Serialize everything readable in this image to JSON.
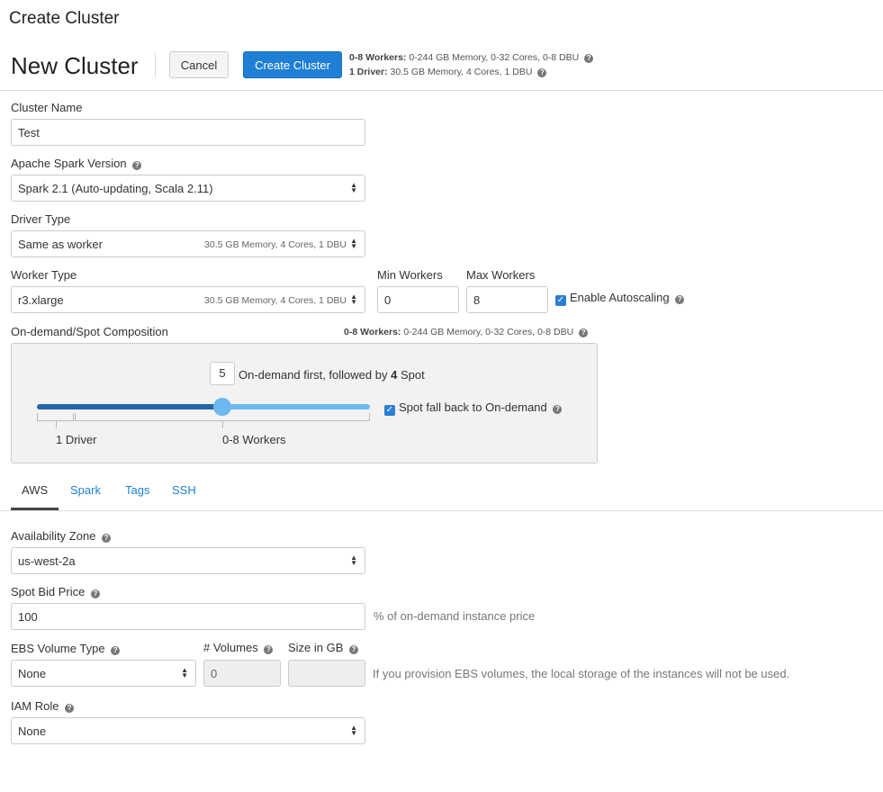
{
  "page": {
    "title": "Create Cluster"
  },
  "header": {
    "heading": "New Cluster",
    "cancel_label": "Cancel",
    "create_label": "Create Cluster",
    "workers_summary_label": "0-8 Workers:",
    "workers_summary_value": "0-244 GB Memory, 0-32 Cores, 0-8 DBU",
    "driver_summary_label": "1 Driver:",
    "driver_summary_value": "30.5 GB Memory, 4 Cores, 1 DBU"
  },
  "form": {
    "cluster_name": {
      "label": "Cluster Name",
      "value": "Test"
    },
    "spark_version": {
      "label": "Apache Spark Version",
      "value": "Spark 2.1 (Auto-updating, Scala 2.11)"
    },
    "driver_type": {
      "label": "Driver Type",
      "value": "Same as worker",
      "meta": "30.5 GB Memory, 4 Cores, 1 DBU"
    },
    "worker_type": {
      "label": "Worker Type",
      "value": "r3.xlarge",
      "meta": "30.5 GB Memory, 4 Cores, 1 DBU"
    },
    "min_workers": {
      "label": "Min Workers",
      "value": "0"
    },
    "max_workers": {
      "label": "Max Workers",
      "value": "8"
    },
    "autoscaling": {
      "label": "Enable Autoscaling",
      "checked": true
    }
  },
  "spot": {
    "label": "On-demand/Spot Composition",
    "summary_label": "0-8 Workers:",
    "summary_value": "0-244 GB Memory, 0-32 Cores, 0-8 DBU",
    "ondemand_count": "5",
    "text_prefix": "On-demand first, followed by",
    "spot_count": "4",
    "text_suffix": "Spot",
    "driver_label": "1 Driver",
    "workers_label": "0-8 Workers",
    "fallback_label": "Spot fall back to On-demand",
    "fallback_checked": true
  },
  "tabs": [
    {
      "label": "AWS",
      "active": true
    },
    {
      "label": "Spark",
      "active": false
    },
    {
      "label": "Tags",
      "active": false
    },
    {
      "label": "SSH",
      "active": false
    }
  ],
  "aws": {
    "availability_zone": {
      "label": "Availability Zone",
      "value": "us-west-2a"
    },
    "spot_bid_price": {
      "label": "Spot Bid Price",
      "value": "100",
      "hint": "% of on-demand instance price"
    },
    "ebs_volume_type": {
      "label": "EBS Volume Type",
      "value": "None"
    },
    "volumes": {
      "label": "# Volumes",
      "value": "0"
    },
    "size_in_gb": {
      "label": "Size in GB",
      "value": ""
    },
    "ebs_hint": "If you provision EBS volumes, the local storage of the instances will not be used.",
    "iam_role": {
      "label": "IAM Role",
      "value": "None"
    }
  }
}
